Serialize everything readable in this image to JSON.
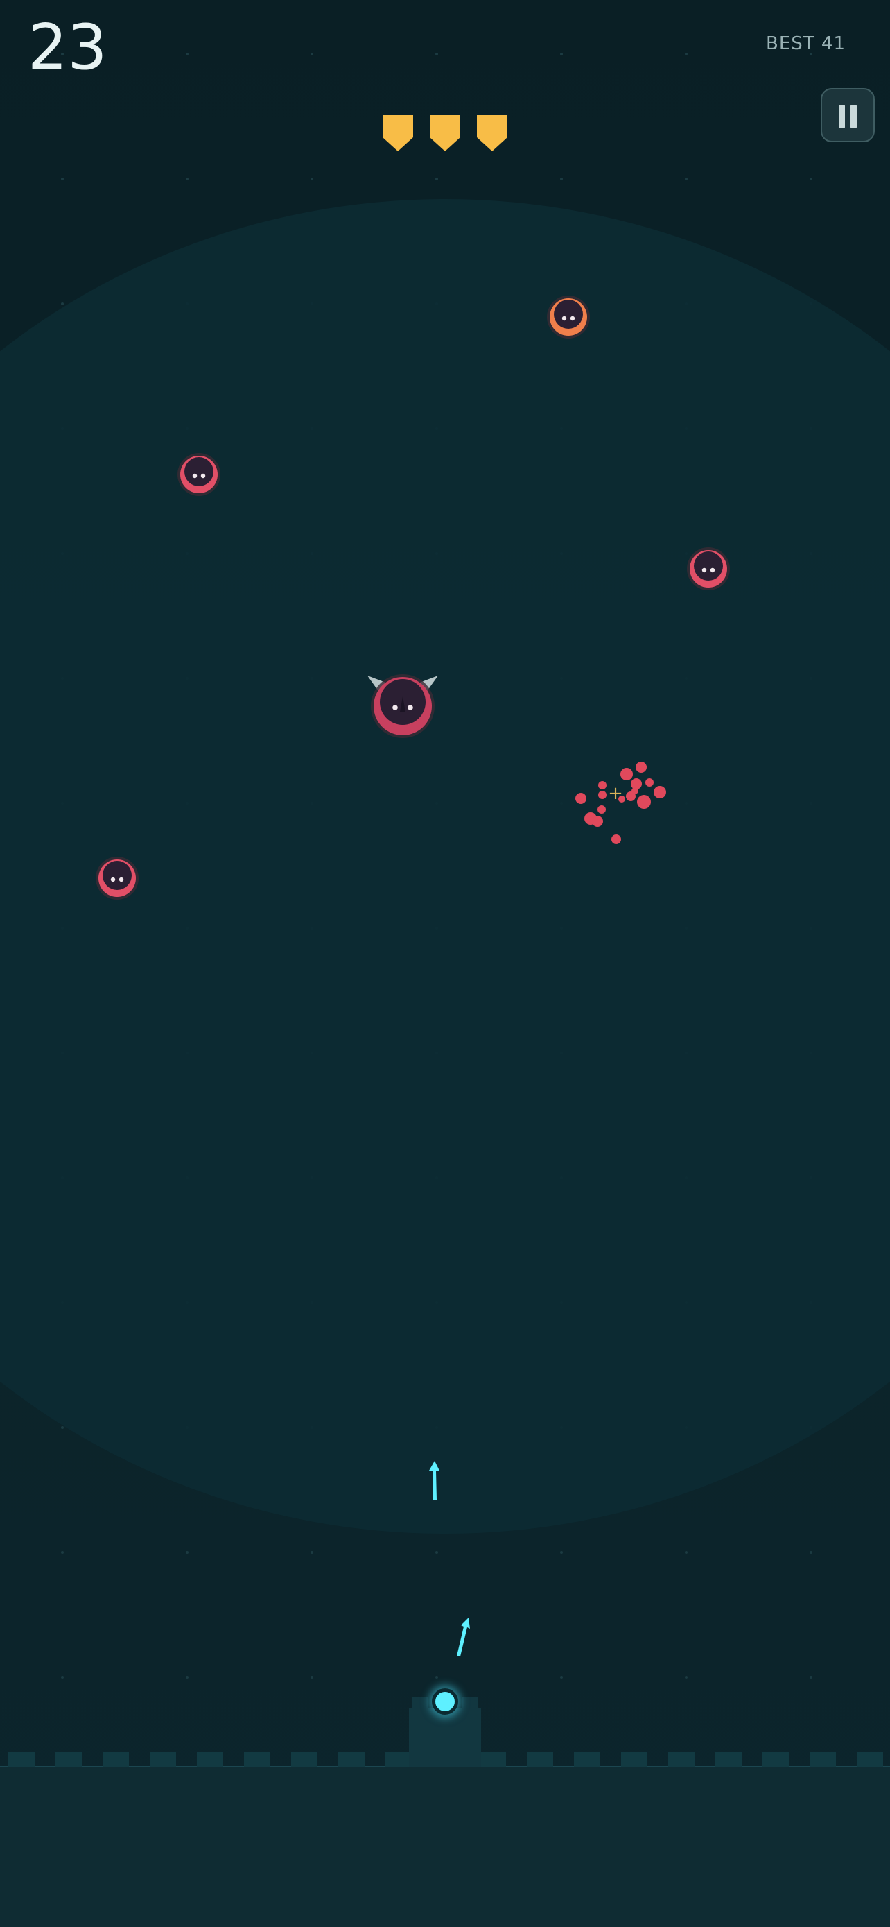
{
  "hud": {
    "score": "23",
    "best_label": "BEST 41",
    "shields_remaining": 3,
    "shield_color": "#f8bd47"
  },
  "colors": {
    "background": "#0b2228",
    "arena": "#0c2b33",
    "ground": "#0f2c33",
    "enemy_red": "#e24f67",
    "enemy_orange": "#f07f4b",
    "enemy_boss": "#c8405f",
    "enemy_core": "#2b1f33",
    "particle": "#e0495c",
    "projectile": "#5ef0ff",
    "pickup_plus": "#d9b45a"
  },
  "enemies": [
    {
      "id": "orange-1",
      "kind": "orange"
    },
    {
      "id": "red-1",
      "kind": "red"
    },
    {
      "id": "red-2",
      "kind": "red"
    },
    {
      "id": "boss-1",
      "kind": "horned"
    },
    {
      "id": "red-3",
      "kind": "red"
    }
  ],
  "pickup_symbol": "+",
  "icons": {
    "pause": "pause-icon",
    "shield": "shield-icon",
    "turret": "turret-icon"
  }
}
